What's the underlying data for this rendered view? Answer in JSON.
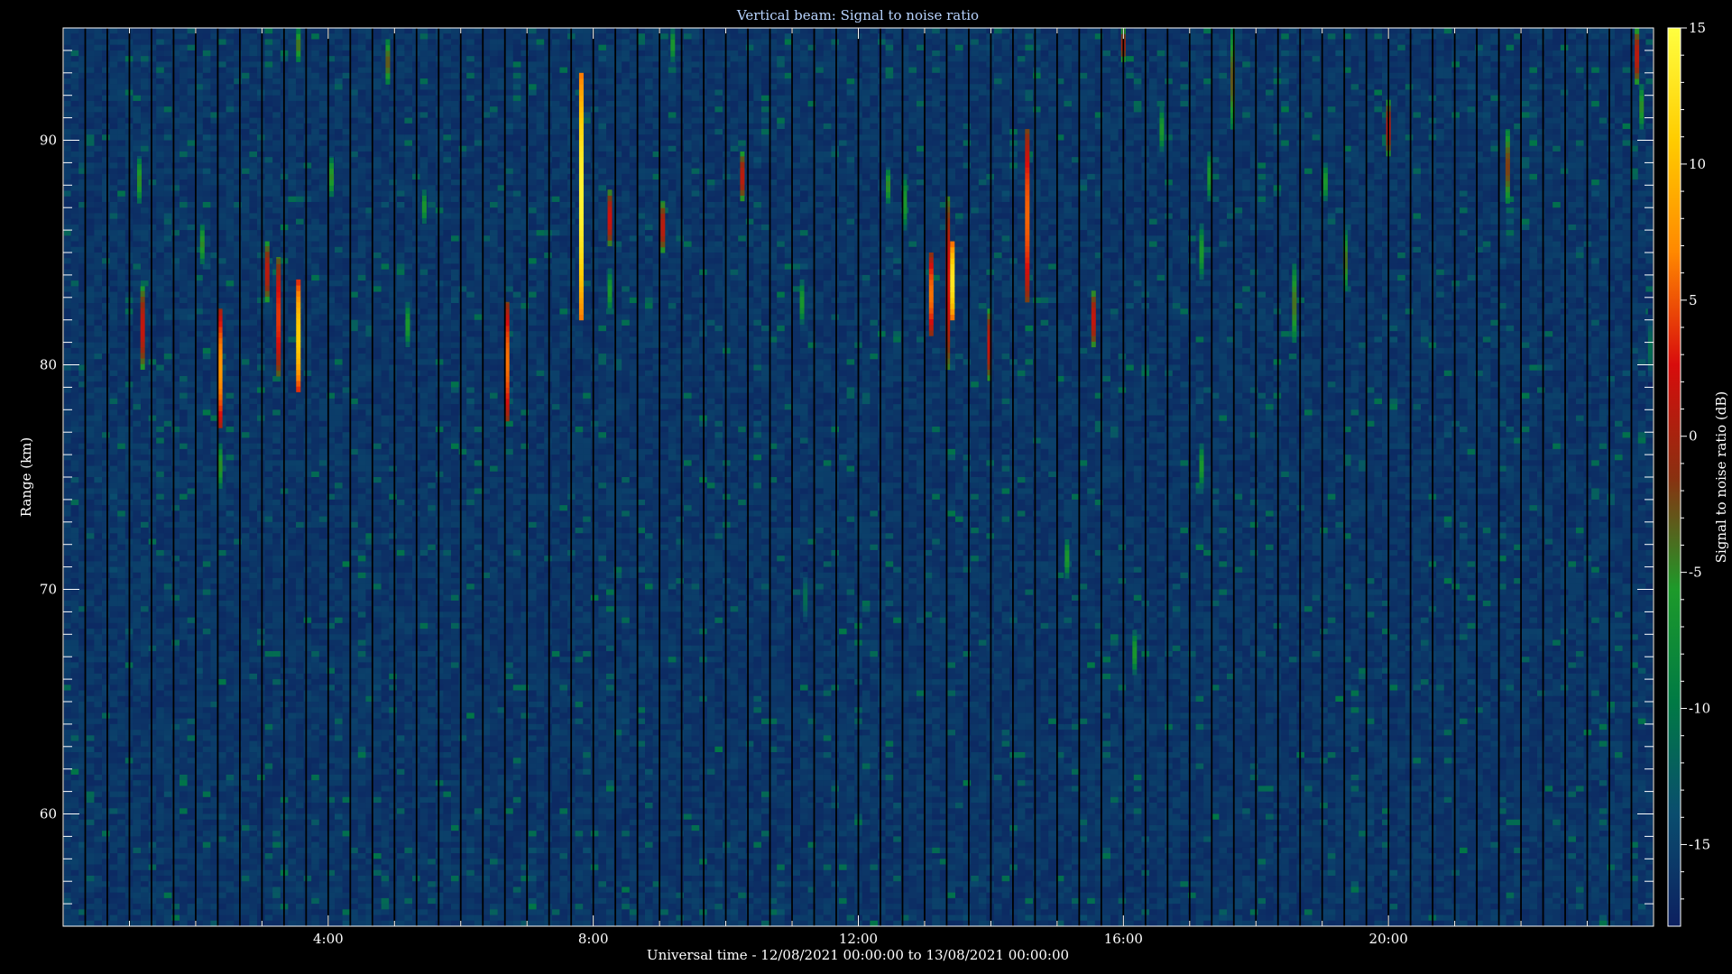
{
  "chart_data": {
    "type": "heatmap",
    "title": "Vertical beam: Signal to noise ratio",
    "xlabel": "Universal time - 12/08/2021 00:00:00 to 13/08/2021 00:00:00",
    "ylabel": "Range (km)",
    "colorbar_label": "Signal to noise ratio (dB)",
    "x_unit": "hours UT",
    "xlim": [
      0,
      24
    ],
    "ylim": [
      55,
      95
    ],
    "x_ticks": [
      {
        "value": 4,
        "label": "4:00"
      },
      {
        "value": 8,
        "label": "8:00"
      },
      {
        "value": 12,
        "label": "12:00"
      },
      {
        "value": 16,
        "label": "16:00"
      },
      {
        "value": 20,
        "label": "20:00"
      }
    ],
    "y_ticks": [
      {
        "value": 60,
        "label": "60"
      },
      {
        "value": 70,
        "label": "70"
      },
      {
        "value": 80,
        "label": "80"
      },
      {
        "value": 90,
        "label": "90"
      }
    ],
    "colorbar_range": [
      -18,
      15
    ],
    "colorbar_ticks": [
      {
        "value": 15,
        "label": "15"
      },
      {
        "value": 10,
        "label": "10"
      },
      {
        "value": 5,
        "label": "5"
      },
      {
        "value": 0,
        "label": "0"
      },
      {
        "value": -5,
        "label": "-5"
      },
      {
        "value": -10,
        "label": "-10"
      },
      {
        "value": -15,
        "label": "-15"
      }
    ],
    "colormap": [
      "#0d2060",
      "#0a4d6e",
      "#007a44",
      "#1d9a2a",
      "#8a3010",
      "#d80c0c",
      "#ff8800",
      "#ffcc00",
      "#ffff40"
    ],
    "background_color": "#000000",
    "noise_floor_db": -16,
    "echoes": [
      {
        "t": 1.2,
        "r0": 79.8,
        "r1": 83.5,
        "peak": 1.5
      },
      {
        "t": 1.15,
        "r0": 87.2,
        "r1": 89.3,
        "peak": -5
      },
      {
        "t": 2.1,
        "r0": 84.5,
        "r1": 86.3,
        "peak": -5
      },
      {
        "t": 2.37,
        "r0": 77.2,
        "r1": 82.5,
        "peak": 7.5
      },
      {
        "t": 2.37,
        "r0": 74.5,
        "r1": 76.5,
        "peak": -5
      },
      {
        "t": 3.08,
        "r0": 82.8,
        "r1": 85.5,
        "peak": 1
      },
      {
        "t": 3.25,
        "r0": 79.5,
        "r1": 84.8,
        "peak": 4
      },
      {
        "t": 3.55,
        "r0": 78.8,
        "r1": 83.8,
        "peak": 11
      },
      {
        "t": 3.55,
        "r0": 93.5,
        "r1": 95,
        "peak": -4
      },
      {
        "t": 4.05,
        "r0": 87.5,
        "r1": 89.3,
        "peak": -5
      },
      {
        "t": 4.9,
        "r0": 92.5,
        "r1": 94.5,
        "peak": -3
      },
      {
        "t": 5.2,
        "r0": 80.8,
        "r1": 82.8,
        "peak": -6
      },
      {
        "t": 5.45,
        "r0": 86.3,
        "r1": 87.8,
        "peak": -6
      },
      {
        "t": 6.7,
        "r0": 77.5,
        "r1": 82.8,
        "peak": 6
      },
      {
        "t": 7.82,
        "r0": 82,
        "r1": 93,
        "peak": 14
      },
      {
        "t": 8.25,
        "r0": 85.3,
        "r1": 87.8,
        "peak": 2
      },
      {
        "t": 8.25,
        "r0": 82.3,
        "r1": 84.3,
        "peak": -6
      },
      {
        "t": 9.05,
        "r0": 85,
        "r1": 87.3,
        "peak": 1
      },
      {
        "t": 9.2,
        "r0": 93.5,
        "r1": 95,
        "peak": -6
      },
      {
        "t": 10.25,
        "r0": 87.3,
        "r1": 89.5,
        "peak": 1
      },
      {
        "t": 11.15,
        "r0": 81.8,
        "r1": 83.8,
        "peak": -6
      },
      {
        "t": 11.2,
        "r0": 68.3,
        "r1": 71,
        "peak": -11
      },
      {
        "t": 12.45,
        "r0": 87.2,
        "r1": 88.8,
        "peak": -5
      },
      {
        "t": 12.7,
        "r0": 86,
        "r1": 88.5,
        "peak": -6
      },
      {
        "t": 13.1,
        "r0": 81.3,
        "r1": 85,
        "peak": 6
      },
      {
        "t": 13.35,
        "r0": 79.8,
        "r1": 87.5,
        "peak": 3
      },
      {
        "t": 13.42,
        "r0": 82,
        "r1": 85.5,
        "peak": 13
      },
      {
        "t": 13.98,
        "r0": 79.3,
        "r1": 82.5,
        "peak": 1.5
      },
      {
        "t": 14.55,
        "r0": 82.8,
        "r1": 90.5,
        "peak": 5.5
      },
      {
        "t": 15.15,
        "r0": 70.5,
        "r1": 72.3,
        "peak": -6
      },
      {
        "t": 15.55,
        "r0": 80.8,
        "r1": 83.3,
        "peak": 1.5
      },
      {
        "t": 16.0,
        "r0": 93.5,
        "r1": 95,
        "peak": 0
      },
      {
        "t": 16.17,
        "r0": 66.2,
        "r1": 68.2,
        "peak": -6
      },
      {
        "t": 16.58,
        "r0": 89.5,
        "r1": 91.5,
        "peak": -6
      },
      {
        "t": 17.3,
        "r0": 87.3,
        "r1": 89.5,
        "peak": -6
      },
      {
        "t": 17.18,
        "r0": 83.8,
        "r1": 86.3,
        "peak": -6
      },
      {
        "t": 17.18,
        "r0": 74.5,
        "r1": 76.5,
        "peak": -6
      },
      {
        "t": 17.65,
        "r0": 90.5,
        "r1": 95,
        "peak": -3
      },
      {
        "t": 18.58,
        "r0": 81,
        "r1": 84.5,
        "peak": -4
      },
      {
        "t": 19.05,
        "r0": 87.3,
        "r1": 89,
        "peak": -6
      },
      {
        "t": 19.35,
        "r0": 83.3,
        "r1": 86,
        "peak": -4
      },
      {
        "t": 20.0,
        "r0": 89.3,
        "r1": 91.8,
        "peak": 1
      },
      {
        "t": 21.8,
        "r0": 87.2,
        "r1": 90.5,
        "peak": -2
      },
      {
        "t": 23.75,
        "r0": 92.5,
        "r1": 95,
        "peak": 1
      },
      {
        "t": 23.82,
        "r0": 90.5,
        "r1": 92.5,
        "peak": -5
      },
      {
        "t": 23.95,
        "r0": 79,
        "r1": 82.5,
        "peak": -11
      }
    ]
  }
}
